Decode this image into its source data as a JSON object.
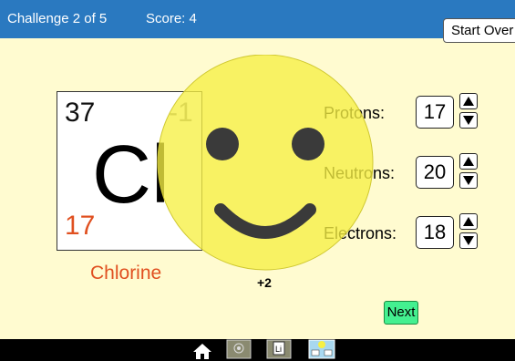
{
  "header": {
    "challenge": "Challenge 2 of 5",
    "score": "Score: 4",
    "start_over": "Start Over"
  },
  "element_card": {
    "mass_number": "37",
    "charge": "-1",
    "symbol": "Cl",
    "atomic_number": "17",
    "name": "Chlorine"
  },
  "net_charge": "+2",
  "particles": [
    {
      "label": "Protons:",
      "value": "17"
    },
    {
      "label": "Neutrons:",
      "value": "20"
    },
    {
      "label": "Electrons:",
      "value": "18"
    }
  ],
  "next_button": "Next",
  "nav": {
    "icons": [
      "home-icon",
      "atom-screen-icon",
      "symbol-screen-icon",
      "game-screen-icon"
    ]
  },
  "colors": {
    "header_bg": "#2a79c0",
    "page_bg": "#fffbd0",
    "accent_orange": "#e05020",
    "next_green": "#44f090",
    "smiley_yellow": "#f6f044"
  }
}
